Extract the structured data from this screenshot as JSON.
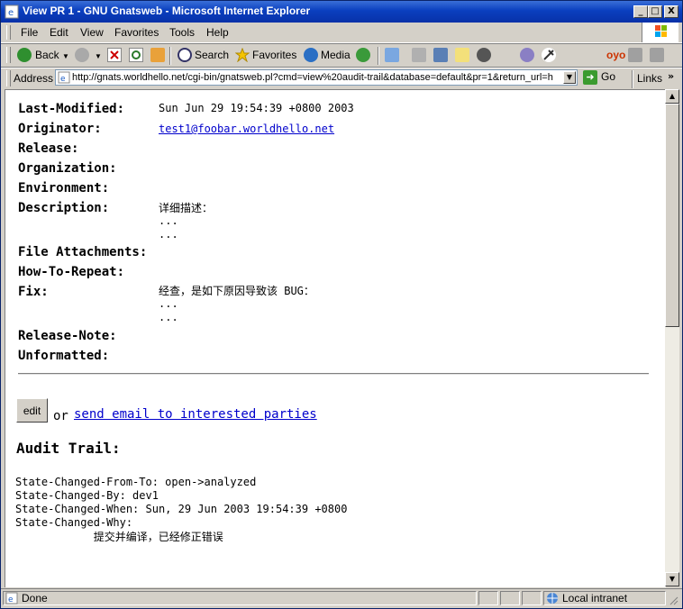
{
  "window": {
    "title": "View PR 1 - GNU Gnatsweb - Microsoft Internet Explorer",
    "btn_min": "_",
    "btn_max": "□",
    "btn_close": "X"
  },
  "menu": {
    "items": [
      "File",
      "Edit",
      "View",
      "Favorites",
      "Tools",
      "Help"
    ]
  },
  "toolbar": {
    "back": "Back",
    "search": "Search",
    "favorites": "Favorites",
    "media": "Media"
  },
  "address": {
    "label": "Address",
    "url": "http://gnats.worldhello.net/cgi-bin/gnatsweb.pl?cmd=view%20audit-trail&database=default&pr=1&return_url=h",
    "go": "Go",
    "links": "Links"
  },
  "pr": {
    "fields": [
      {
        "label": "Last-Modified:",
        "value": "Sun Jun 29 19:54:39 +0800 2003"
      },
      {
        "label": "Originator:",
        "value": "test1@foobar.worldhello.net"
      },
      {
        "label": "Release:",
        "value": ""
      },
      {
        "label": "Organization:",
        "value": ""
      },
      {
        "label": "Environment:",
        "value": ""
      },
      {
        "label": "Description:",
        "value": "详细描述："
      },
      {
        "label": "File Attachments:",
        "value": ""
      },
      {
        "label": "How-To-Repeat:",
        "value": ""
      },
      {
        "label": "Fix:",
        "value": "经查，是如下原因导致该 BUG："
      },
      {
        "label": "Release-Note:",
        "value": ""
      },
      {
        "label": "Unformatted:",
        "value": ""
      }
    ],
    "ellipsis": "..."
  },
  "actions": {
    "edit": "edit",
    "or": "or",
    "send_email": "send email to interested parties"
  },
  "audit": {
    "heading": "Audit Trail:",
    "lines": [
      "State-Changed-From-To: open->analyzed",
      "State-Changed-By: dev1",
      "State-Changed-When: Sun, 29 Jun 2003 19:54:39 +0800",
      "State-Changed-Why:",
      "            提交并编译，已经修正错误"
    ]
  },
  "status": {
    "text": "Done",
    "zone": "Local intranet"
  }
}
